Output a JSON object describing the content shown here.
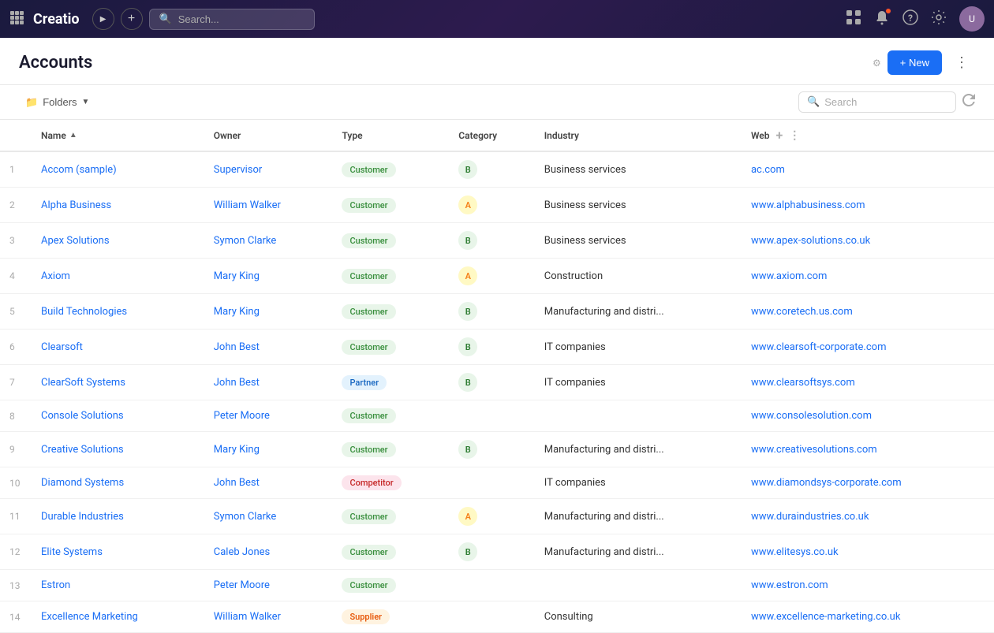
{
  "app": {
    "name": "Creatio"
  },
  "topnav": {
    "search_placeholder": "Search...",
    "icons": [
      "grid",
      "play",
      "add",
      "search"
    ]
  },
  "page": {
    "title": "Accounts",
    "new_button": "+ New",
    "folders_label": "Folders",
    "search_placeholder": "Search"
  },
  "table": {
    "columns": [
      "Name",
      "Owner",
      "Type",
      "Category",
      "Industry",
      "Web"
    ],
    "rows": [
      {
        "num": 1,
        "name": "Accom (sample)",
        "owner": "Supervisor",
        "type": "Customer",
        "type_class": "customer",
        "category": "B",
        "cat_class": "b",
        "industry": "Business services",
        "web": "ac.com"
      },
      {
        "num": 2,
        "name": "Alpha Business",
        "owner": "William Walker",
        "type": "Customer",
        "type_class": "customer",
        "category": "A",
        "cat_class": "a",
        "industry": "Business services",
        "web": "www.alphabusiness.com"
      },
      {
        "num": 3,
        "name": "Apex Solutions",
        "owner": "Symon Clarke",
        "type": "Customer",
        "type_class": "customer",
        "category": "B",
        "cat_class": "b",
        "industry": "Business services",
        "web": "www.apex-solutions.co.uk"
      },
      {
        "num": 4,
        "name": "Axiom",
        "owner": "Mary King",
        "type": "Customer",
        "type_class": "customer",
        "category": "A",
        "cat_class": "a",
        "industry": "Construction",
        "web": "www.axiom.com"
      },
      {
        "num": 5,
        "name": "Build Technologies",
        "owner": "Mary King",
        "type": "Customer",
        "type_class": "customer",
        "category": "B",
        "cat_class": "b",
        "industry": "Manufacturing and distri...",
        "web": "www.coretech.us.com"
      },
      {
        "num": 6,
        "name": "Clearsoft",
        "owner": "John Best",
        "type": "Customer",
        "type_class": "customer",
        "category": "B",
        "cat_class": "b",
        "industry": "IT companies",
        "web": "www.clearsoft-corporate.com"
      },
      {
        "num": 7,
        "name": "ClearSoft Systems",
        "owner": "John Best",
        "type": "Partner",
        "type_class": "partner",
        "category": "B",
        "cat_class": "b",
        "industry": "IT companies",
        "web": "www.clearsoftsys.com"
      },
      {
        "num": 8,
        "name": "Console Solutions",
        "owner": "Peter Moore",
        "type": "Customer",
        "type_class": "customer",
        "category": "",
        "cat_class": "",
        "industry": "",
        "web": "www.consolesolution.com"
      },
      {
        "num": 9,
        "name": "Creative Solutions",
        "owner": "Mary King",
        "type": "Customer",
        "type_class": "customer",
        "category": "B",
        "cat_class": "b",
        "industry": "Manufacturing and distri...",
        "web": "www.creativesolutions.com"
      },
      {
        "num": 10,
        "name": "Diamond Systems",
        "owner": "John Best",
        "type": "Competitor",
        "type_class": "competitor",
        "category": "",
        "cat_class": "",
        "industry": "IT companies",
        "web": "www.diamondsys-corporate.com"
      },
      {
        "num": 11,
        "name": "Durable Industries",
        "owner": "Symon Clarke",
        "type": "Customer",
        "type_class": "customer",
        "category": "A",
        "cat_class": "a",
        "industry": "Manufacturing and distri...",
        "web": "www.duraindustries.co.uk"
      },
      {
        "num": 12,
        "name": "Elite Systems",
        "owner": "Caleb Jones",
        "type": "Customer",
        "type_class": "customer",
        "category": "B",
        "cat_class": "b",
        "industry": "Manufacturing and distri...",
        "web": "www.elitesys.co.uk"
      },
      {
        "num": 13,
        "name": "Estron",
        "owner": "Peter Moore",
        "type": "Customer",
        "type_class": "customer",
        "category": "",
        "cat_class": "",
        "industry": "",
        "web": "www.estron.com"
      },
      {
        "num": 14,
        "name": "Excellence Marketing",
        "owner": "William Walker",
        "type": "Supplier",
        "type_class": "supplier",
        "category": "",
        "cat_class": "",
        "industry": "Consulting",
        "web": "www.excellence-marketing.co.uk"
      }
    ]
  }
}
